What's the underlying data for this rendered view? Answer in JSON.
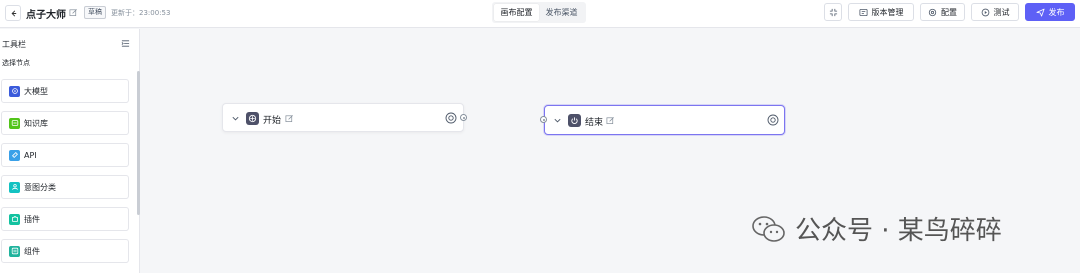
{
  "header": {
    "back_icon": "arrow-left-icon",
    "title": "点子大师",
    "badge": "草稿",
    "updated": "更新于：23:00:53",
    "tabs": [
      {
        "label": "画布配置",
        "active": true
      },
      {
        "label": "发布渠道",
        "active": false
      }
    ],
    "buttons": {
      "fit": "",
      "version": "版本管理",
      "config": "配置",
      "test": "测试",
      "publish": "发布"
    },
    "accent": "#5e60f6"
  },
  "sidebar": {
    "title": "工具栏",
    "subtitle": "选择节点",
    "items": [
      {
        "label": "大模型",
        "icon": "model-icon",
        "color": "#3b5bdb"
      },
      {
        "label": "知识库",
        "icon": "knowledge-icon",
        "color": "#52c41a"
      },
      {
        "label": "API",
        "icon": "api-icon",
        "color": "#3aa0e8"
      },
      {
        "label": "意图分类",
        "icon": "intent-icon",
        "color": "#13c2c2"
      },
      {
        "label": "插件",
        "icon": "plugin-icon",
        "color": "#13c2a0"
      },
      {
        "label": "组件",
        "icon": "component-icon",
        "color": "#20b39d"
      }
    ]
  },
  "canvas": {
    "nodes": [
      {
        "label": "开始",
        "icon": "start-icon"
      },
      {
        "label": "结束",
        "icon": "power-icon",
        "selected": true
      }
    ],
    "selected_color": "#7c75f0"
  },
  "watermark": {
    "text": "公众号 · 某鸟碎碎",
    "icon": "wechat-icon"
  }
}
